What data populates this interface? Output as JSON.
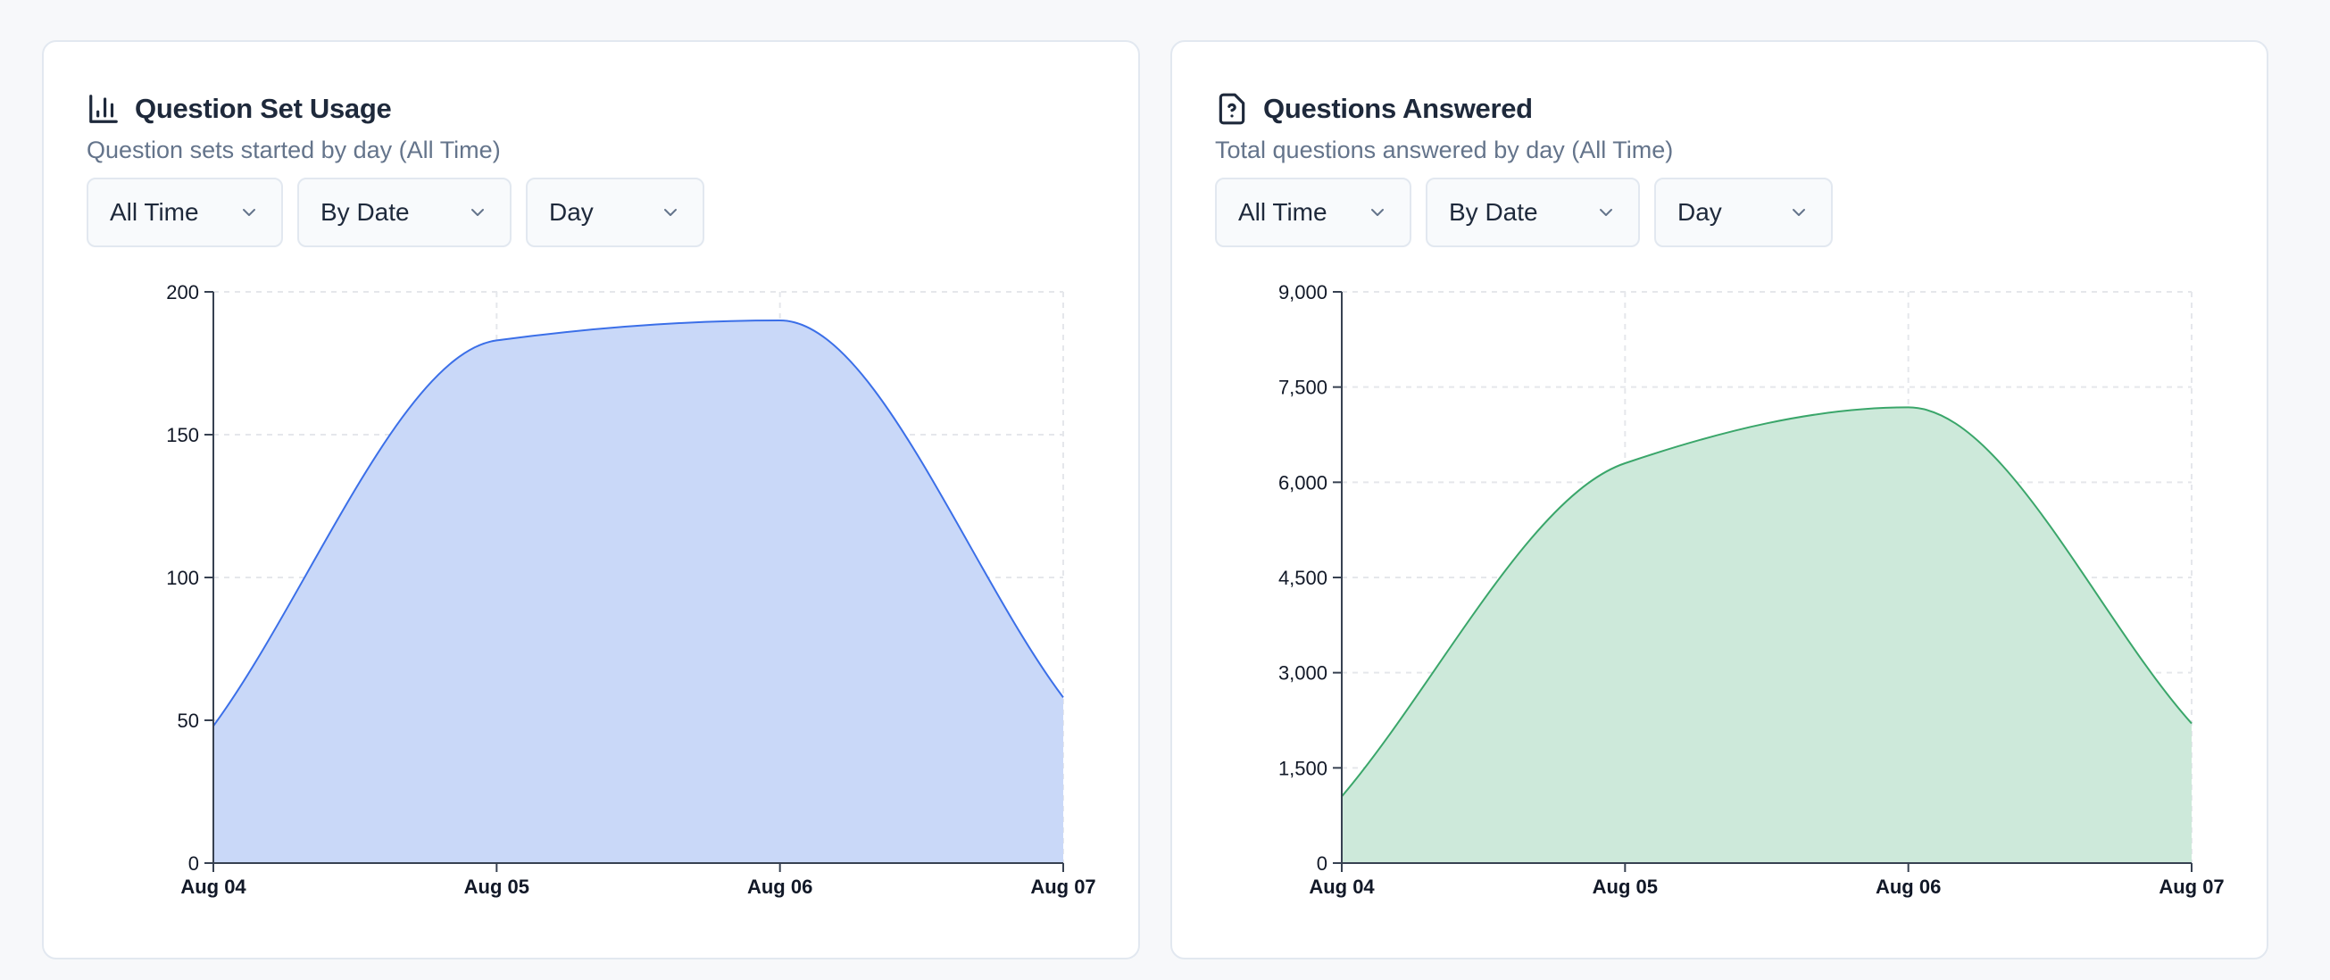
{
  "cards": [
    {
      "title": "Question Set Usage",
      "subtitle": "Question sets started by day (All Time)",
      "icon": "bar-chart-icon",
      "filters": [
        {
          "value": "All Time"
        },
        {
          "value": "By Date"
        },
        {
          "value": "Day"
        }
      ],
      "chart_data": {
        "type": "area",
        "categories": [
          "Aug 04",
          "Aug 05",
          "Aug 06",
          "Aug 07"
        ],
        "x": [
          "Aug 04",
          "Aug 05",
          "Aug 06",
          "Aug 07"
        ],
        "series": [
          {
            "values": [
              48,
              183,
              190,
              58
            ],
            "color": "#3b6fe8",
            "fill": "#c9d8f8"
          }
        ],
        "ylim": [
          0,
          200
        ],
        "yticks": [
          0,
          50,
          100,
          150,
          200
        ],
        "ytick_labels": [
          "0",
          "50",
          "100",
          "150",
          "200"
        ],
        "grid": true,
        "title": "",
        "xlabel": "",
        "ylabel": ""
      }
    },
    {
      "title": "Questions Answered",
      "subtitle": "Total questions answered by day (All Time)",
      "icon": "file-question-icon",
      "filters": [
        {
          "value": "All Time"
        },
        {
          "value": "By Date"
        },
        {
          "value": "Day"
        }
      ],
      "chart_data": {
        "type": "area",
        "categories": [
          "Aug 04",
          "Aug 05",
          "Aug 06",
          "Aug 07"
        ],
        "x": [
          "Aug 04",
          "Aug 05",
          "Aug 06",
          "Aug 07"
        ],
        "series": [
          {
            "values": [
              1050,
              6300,
              7180,
              2200
            ],
            "color": "#3aa66a",
            "fill": "#cde9da"
          }
        ],
        "ylim": [
          0,
          9000
        ],
        "yticks": [
          0,
          1500,
          3000,
          4500,
          6000,
          7500,
          9000
        ],
        "ytick_labels": [
          "0",
          "1,500",
          "3,000",
          "4,500",
          "6,000",
          "7,500",
          "9,000"
        ],
        "grid": true,
        "title": "",
        "xlabel": "",
        "ylabel": ""
      }
    }
  ]
}
